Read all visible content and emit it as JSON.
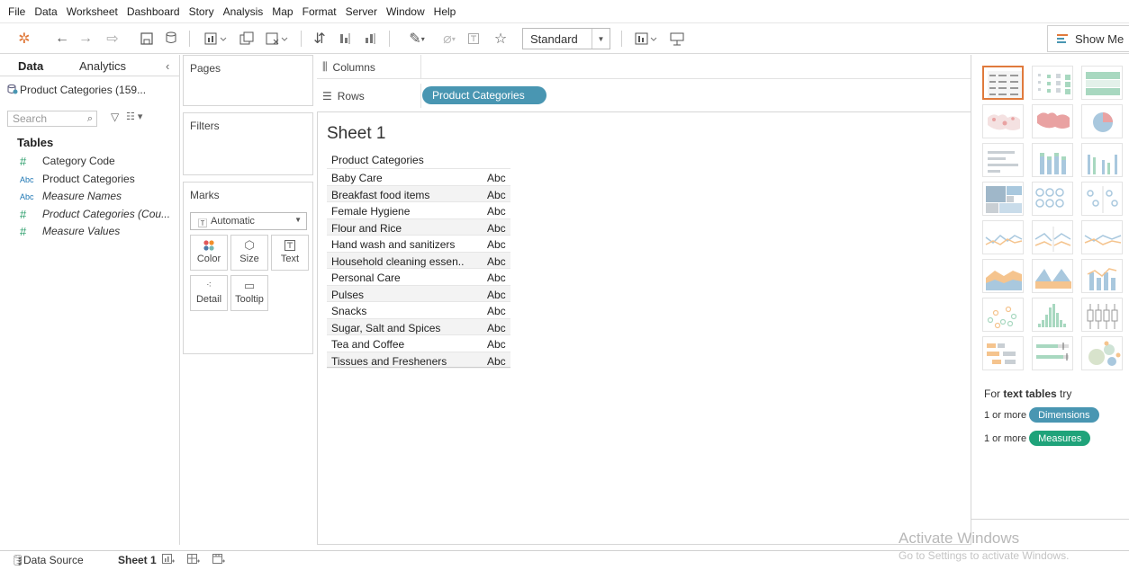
{
  "menu": [
    "File",
    "Data",
    "Worksheet",
    "Dashboard",
    "Story",
    "Analysis",
    "Map",
    "Format",
    "Server",
    "Window",
    "Help"
  ],
  "toolbar": {
    "fit_value": "Standard",
    "show_me_label": "Show Me"
  },
  "data_pane": {
    "tabs": [
      "Data",
      "Analytics"
    ],
    "datasource": "Product Categories (159...",
    "search_placeholder": "Search",
    "tables_heading": "Tables",
    "fields": [
      {
        "icon": "#",
        "type": "number",
        "name": "Category Code",
        "italic": false
      },
      {
        "icon": "Abc",
        "type": "string",
        "name": "Product Categories",
        "italic": false
      },
      {
        "icon": "Abc",
        "type": "string",
        "name": "Measure Names",
        "italic": true
      },
      {
        "icon": "#",
        "type": "number",
        "name": "Product Categories (Cou...",
        "italic": true
      },
      {
        "icon": "#",
        "type": "number",
        "name": "Measure Values",
        "italic": true
      }
    ]
  },
  "shelves": {
    "pages": "Pages",
    "filters": "Filters",
    "marks": "Marks",
    "mark_type": "Automatic",
    "mark_buttons": [
      "Color",
      "Size",
      "Text",
      "Detail",
      "Tooltip"
    ],
    "columns_label": "Columns",
    "rows_label": "Rows",
    "rows_pill": "Product Categories"
  },
  "view": {
    "sheet_title": "Sheet 1",
    "column_header": "Product Categories",
    "rows": [
      {
        "category": "Baby Care",
        "value": "Abc"
      },
      {
        "category": "Breakfast food items",
        "value": "Abc"
      },
      {
        "category": "Female Hygiene",
        "value": "Abc"
      },
      {
        "category": "Flour and Rice",
        "value": "Abc"
      },
      {
        "category": "Hand wash and sanitizers",
        "value": "Abc"
      },
      {
        "category": "Household cleaning essen..",
        "value": "Abc"
      },
      {
        "category": "Personal Care",
        "value": "Abc"
      },
      {
        "category": "Pulses",
        "value": "Abc"
      },
      {
        "category": "Snacks",
        "value": "Abc"
      },
      {
        "category": "Sugar, Salt and Spices",
        "value": "Abc"
      },
      {
        "category": "Tea and Coffee",
        "value": "Abc"
      },
      {
        "category": "Tissues and Fresheners",
        "value": "Abc"
      }
    ]
  },
  "show_me": {
    "hint_prefix": "For",
    "hint_bold": "text tables",
    "hint_suffix": "try",
    "req_prefix": "1 or more",
    "dimensions": "Dimensions",
    "measures": "Measures",
    "dimensions_color": "#4996b2",
    "measures_color": "#1fa37a",
    "selected_color": "#e07a3c"
  },
  "bottom_tabs": {
    "data_source": "Data Source",
    "sheet": "Sheet 1"
  },
  "watermark": {
    "line1": "Activate Windows",
    "line2": "Go to Settings to activate Windows."
  }
}
